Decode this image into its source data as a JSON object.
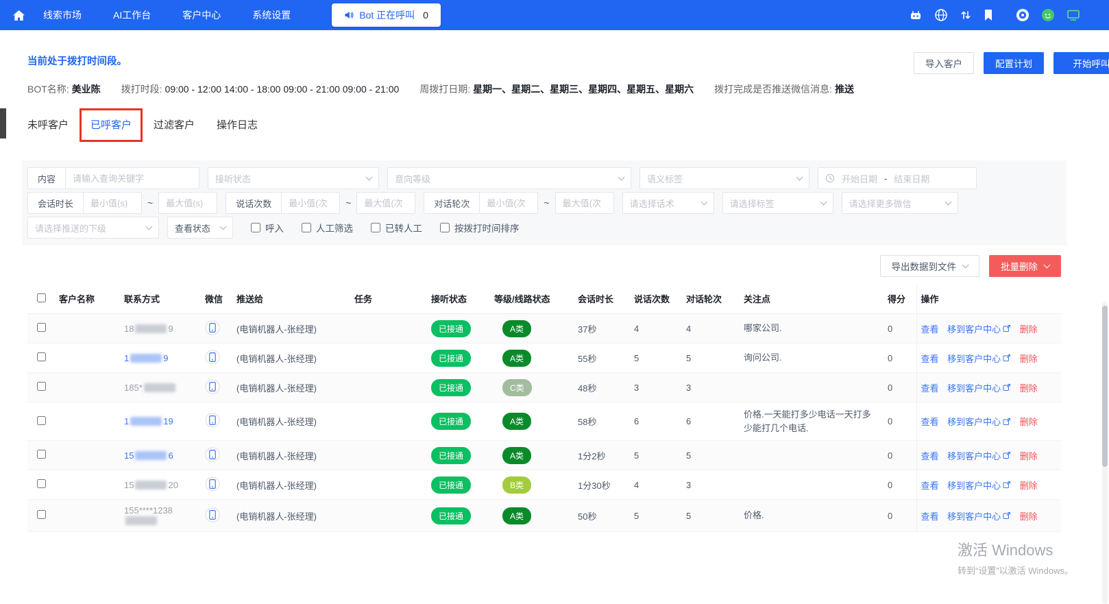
{
  "topnav": {
    "items": [
      {
        "label": "线索市场"
      },
      {
        "label": "AI工作台"
      },
      {
        "label": "客户中心"
      },
      {
        "label": "系统设置"
      }
    ],
    "bot_call_label": "Bot 正在呼叫",
    "bot_call_count": "0"
  },
  "header": {
    "status_text": "当前处于拨打时间段。",
    "import_button": "导入客户",
    "configure_button": "配置计划",
    "start_call_button": "开始呼叫"
  },
  "bot_info": {
    "name_label": "BOT名称:",
    "name_value": "美业陈",
    "period_label": "拨打时段:",
    "period_value": "09:00 - 12:00 14:00 - 18:00 09:00 - 21:00 09:00 - 21:00",
    "weekday_label": "周拨打日期:",
    "weekday_value": "星期一、星期二、星期三、星期四、星期五、星期六",
    "push_label": "拨打完成是否推送微信消息:",
    "push_value": "推送"
  },
  "tabs": [
    {
      "label": "未呼客户"
    },
    {
      "label": "已呼客户"
    },
    {
      "label": "过滤客户"
    },
    {
      "label": "操作日志"
    }
  ],
  "filters": {
    "content_label": "内容",
    "content_placeholder": "请输入查询关键字",
    "answer_status_placeholder": "接听状态",
    "intent_level_placeholder": "意向等级",
    "semantic_tag_placeholder": "语义标签",
    "start_date_placeholder": "开始日期",
    "date_separator": "-",
    "end_date_placeholder": "结束日期",
    "session_duration_label": "会话时长",
    "session_min_placeholder": "最小值(s)",
    "session_max_placeholder": "最大值(s)",
    "tilde": "~",
    "speak_count_label": "说话次数",
    "speak_min_placeholder": "最小值(次",
    "speak_max_placeholder": "最大值(次",
    "rounds_label": "对话轮次",
    "rounds_min_placeholder": "最小值(次",
    "rounds_max_placeholder": "最大值(次",
    "script_placeholder": "请选择话术",
    "tag_placeholder": "请选择标签",
    "more_wechat_placeholder": "请选择更多微信",
    "subordinate_placeholder": "请选择推送的下级",
    "view_status_label": "查看状态",
    "checkboxes": [
      "呼入",
      "人工筛选",
      "已转人工",
      "按拨打时间排序"
    ]
  },
  "toolbar": {
    "export_button": "导出数据到文件",
    "batch_delete_button": "批量删除"
  },
  "table": {
    "headers": [
      "客户名称",
      "联系方式",
      "微信",
      "推送给",
      "任务",
      "接听状态",
      "等级/线路状态",
      "会话时长",
      "说话次数",
      "对话轮次",
      "关注点",
      "得分",
      "操作"
    ],
    "actions": {
      "view": "查看",
      "move": "移到客户中心",
      "delete": "删除"
    },
    "rows": [
      {
        "phone_prefix": "18",
        "phone_suffix": "9",
        "phone_class": "phone-gray",
        "push_to": "(电销机器人-张经理)",
        "task": "",
        "answer_status": "已接通",
        "level": "A类",
        "level_class": "level-a",
        "duration": "37秒",
        "speak_count": "4",
        "rounds": "4",
        "focus": "哪家公司.",
        "score": "0"
      },
      {
        "phone_prefix": "1",
        "phone_suffix": "9",
        "phone_class": "phone-blue",
        "push_to": "(电销机器人-张经理)",
        "task": "",
        "answer_status": "已接通",
        "level": "A类",
        "level_class": "level-a",
        "duration": "55秒",
        "speak_count": "5",
        "rounds": "5",
        "focus": "询问公司.",
        "score": "0"
      },
      {
        "phone_prefix": "185*",
        "phone_suffix": "",
        "phone_class": "phone-gray",
        "push_to": "(电销机器人-张经理)",
        "task": "",
        "answer_status": "已接通",
        "level": "C类",
        "level_class": "level-c",
        "duration": "48秒",
        "speak_count": "3",
        "rounds": "3",
        "focus": "",
        "score": "0"
      },
      {
        "phone_prefix": "1",
        "phone_suffix": "19",
        "phone_class": "phone-blue",
        "push_to": "(电销机器人-张经理)",
        "task": "",
        "answer_status": "已接通",
        "level": "A类",
        "level_class": "level-a",
        "duration": "58秒",
        "speak_count": "6",
        "rounds": "6",
        "focus": "价格.一天能打多少电话一天打多少能打几个电话.",
        "score": "0"
      },
      {
        "phone_prefix": "15",
        "phone_suffix": "6",
        "phone_class": "phone-blue",
        "push_to": "(电销机器人-张经理)",
        "task": "",
        "answer_status": "已接通",
        "level": "A类",
        "level_class": "level-a",
        "duration": "1分2秒",
        "speak_count": "5",
        "rounds": "5",
        "focus": "",
        "score": "0"
      },
      {
        "phone_prefix": "15",
        "phone_suffix": "20",
        "phone_class": "phone-gray",
        "push_to": "(电销机器人-张经理)",
        "task": "",
        "answer_status": "已接通",
        "level": "B类",
        "level_class": "level-b",
        "duration": "1分30秒",
        "speak_count": "4",
        "rounds": "3",
        "focus": "",
        "score": "0"
      },
      {
        "phone_prefix": "155****1238",
        "phone_suffix": "",
        "phone_class": "phone-gray",
        "push_to": "(电销机器人-张经理)",
        "task": "",
        "answer_status": "已接通",
        "level": "A类",
        "level_class": "level-a",
        "duration": "50秒",
        "speak_count": "5",
        "rounds": "5",
        "focus": "价格.",
        "score": "0"
      }
    ]
  },
  "watermark": {
    "line1": "激活 Windows",
    "line2": "转到“设置”以激活 Windows。"
  }
}
